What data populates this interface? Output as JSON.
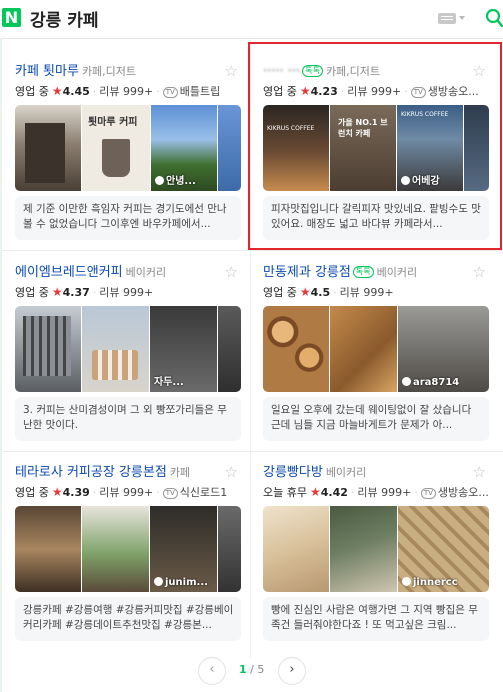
{
  "header": {
    "logo": "N",
    "query": "강릉 카페"
  },
  "cards": [
    {
      "name": "카페 툇마루",
      "category": "카페,디저트",
      "naver_pay": "",
      "status": "영업 중",
      "rating": "4.45",
      "reviews": "리뷰 999+",
      "tv": "TV",
      "tv_label": "배틀트립",
      "photo_tag": "안녕...",
      "review": "제 기준 이만한 흑임자 커피는 경기도에선 만나볼 수 없었습니다 그이후엔 바우카페에서..."
    },
    {
      "name": "·····  ···",
      "category": "카페,디저트",
      "naver_pay": "톡톡",
      "status": "영업 중",
      "rating": "4.23",
      "reviews": "리뷰 999+",
      "tv": "TV",
      "tv_label": "생방송오...",
      "photo_tag": "어베강",
      "review": "피자맛집입니다 갈릭피자 맛있네요. 팥빙수도 맛있어요. 매장도 넓고 바다뷰 카페라서..."
    },
    {
      "name": "에이엠브레드앤커피",
      "category": "베이커리",
      "naver_pay": "",
      "status": "영업 중",
      "rating": "4.37",
      "reviews": "리뷰 999+",
      "tv": "",
      "tv_label": "",
      "photo_tag": "자두...",
      "review": "3. 커피는 산미겸성이며 그 외 빵쪼가리들은 무난한 맛이다."
    },
    {
      "name": "만동제과 강릉점",
      "category": "베이커리",
      "naver_pay": "톡톡",
      "status": "영업 중",
      "rating": "4.5",
      "reviews": "리뷰 999+",
      "tv": "",
      "tv_label": "",
      "photo_tag": "ara8714",
      "review": "일요일 오후에 갔는데 웨이팅없이 잘 샀습니다 근데 님들 지금 마늘바게트가 문제가 아..."
    },
    {
      "name": "테라로사 커피공장 강릉본점",
      "category": "카페",
      "naver_pay": "",
      "status": "영업 중",
      "rating": "4.39",
      "reviews": "리뷰 999+",
      "tv": "TV",
      "tv_label": "식신로드1",
      "photo_tag": "junim...",
      "review": "강릉카페 #강릉여행 #강릉커피맛집 #강릉베이커리카페 #강릉데이트추천맛집 #강릉본..."
    },
    {
      "name": "강릉빵다방",
      "category": "베이커리",
      "naver_pay": "",
      "status": "오늘 휴무",
      "rating": "4.42",
      "reviews": "리뷰 999+",
      "tv": "TV",
      "tv_label": "생방송오...",
      "photo_tag": "jinnercc",
      "review": "빵에 진심인 사람은 여행가면 그 지역 빵집은 무족건 들러줘야한다죠 ! 또 먹고싶은 크림..."
    }
  ],
  "photo_texts": {
    "card1_sign": "툇마루 커피",
    "card2_a": "KIKRUS COFFEE",
    "card2_b": "가을 NO.1 브런치 카페",
    "card2_c": "KIKRUS COFFEE",
    "card6_sign": "빵다"
  },
  "pager": {
    "current": "1",
    "separator": "/",
    "total": "5",
    "prev": "‹",
    "next": "›"
  },
  "colors": {
    "accent": "#03c75a",
    "link": "#0a4ab0",
    "highlight": "#e2262b",
    "star": "#e63b3b"
  }
}
